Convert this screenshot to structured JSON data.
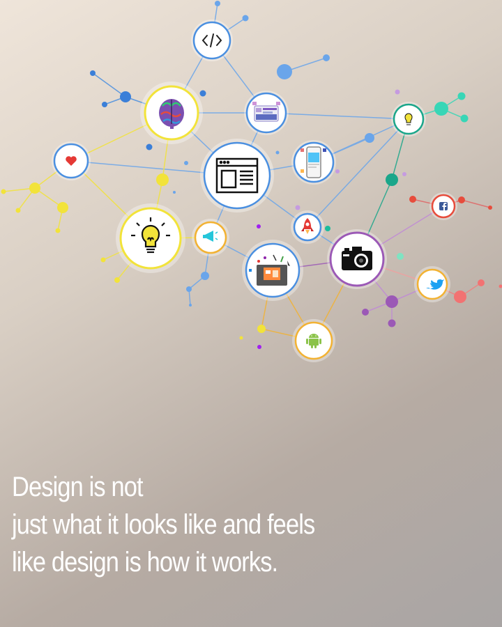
{
  "quote": {
    "line1": "Design is not",
    "line2": "just what it looks like and feels",
    "line3": "like design is how it works."
  },
  "colors": {
    "blue": "#4a8fe0",
    "yellow": "#f2e33a",
    "orange": "#f2b233",
    "purple": "#9b59b6",
    "teal": "#1abc9c",
    "red": "#e74c3c",
    "text": "#ffffff"
  },
  "icons": [
    "code-icon",
    "brain-icon",
    "website-icon",
    "dashboard-icon",
    "mobile-app-icon",
    "heart-icon",
    "lightbulb-icon",
    "small-lightbulb-icon",
    "megaphone-icon",
    "rocket-icon",
    "design-tools-icon",
    "camera-icon",
    "facebook-icon",
    "twitter-icon",
    "android-icon"
  ]
}
